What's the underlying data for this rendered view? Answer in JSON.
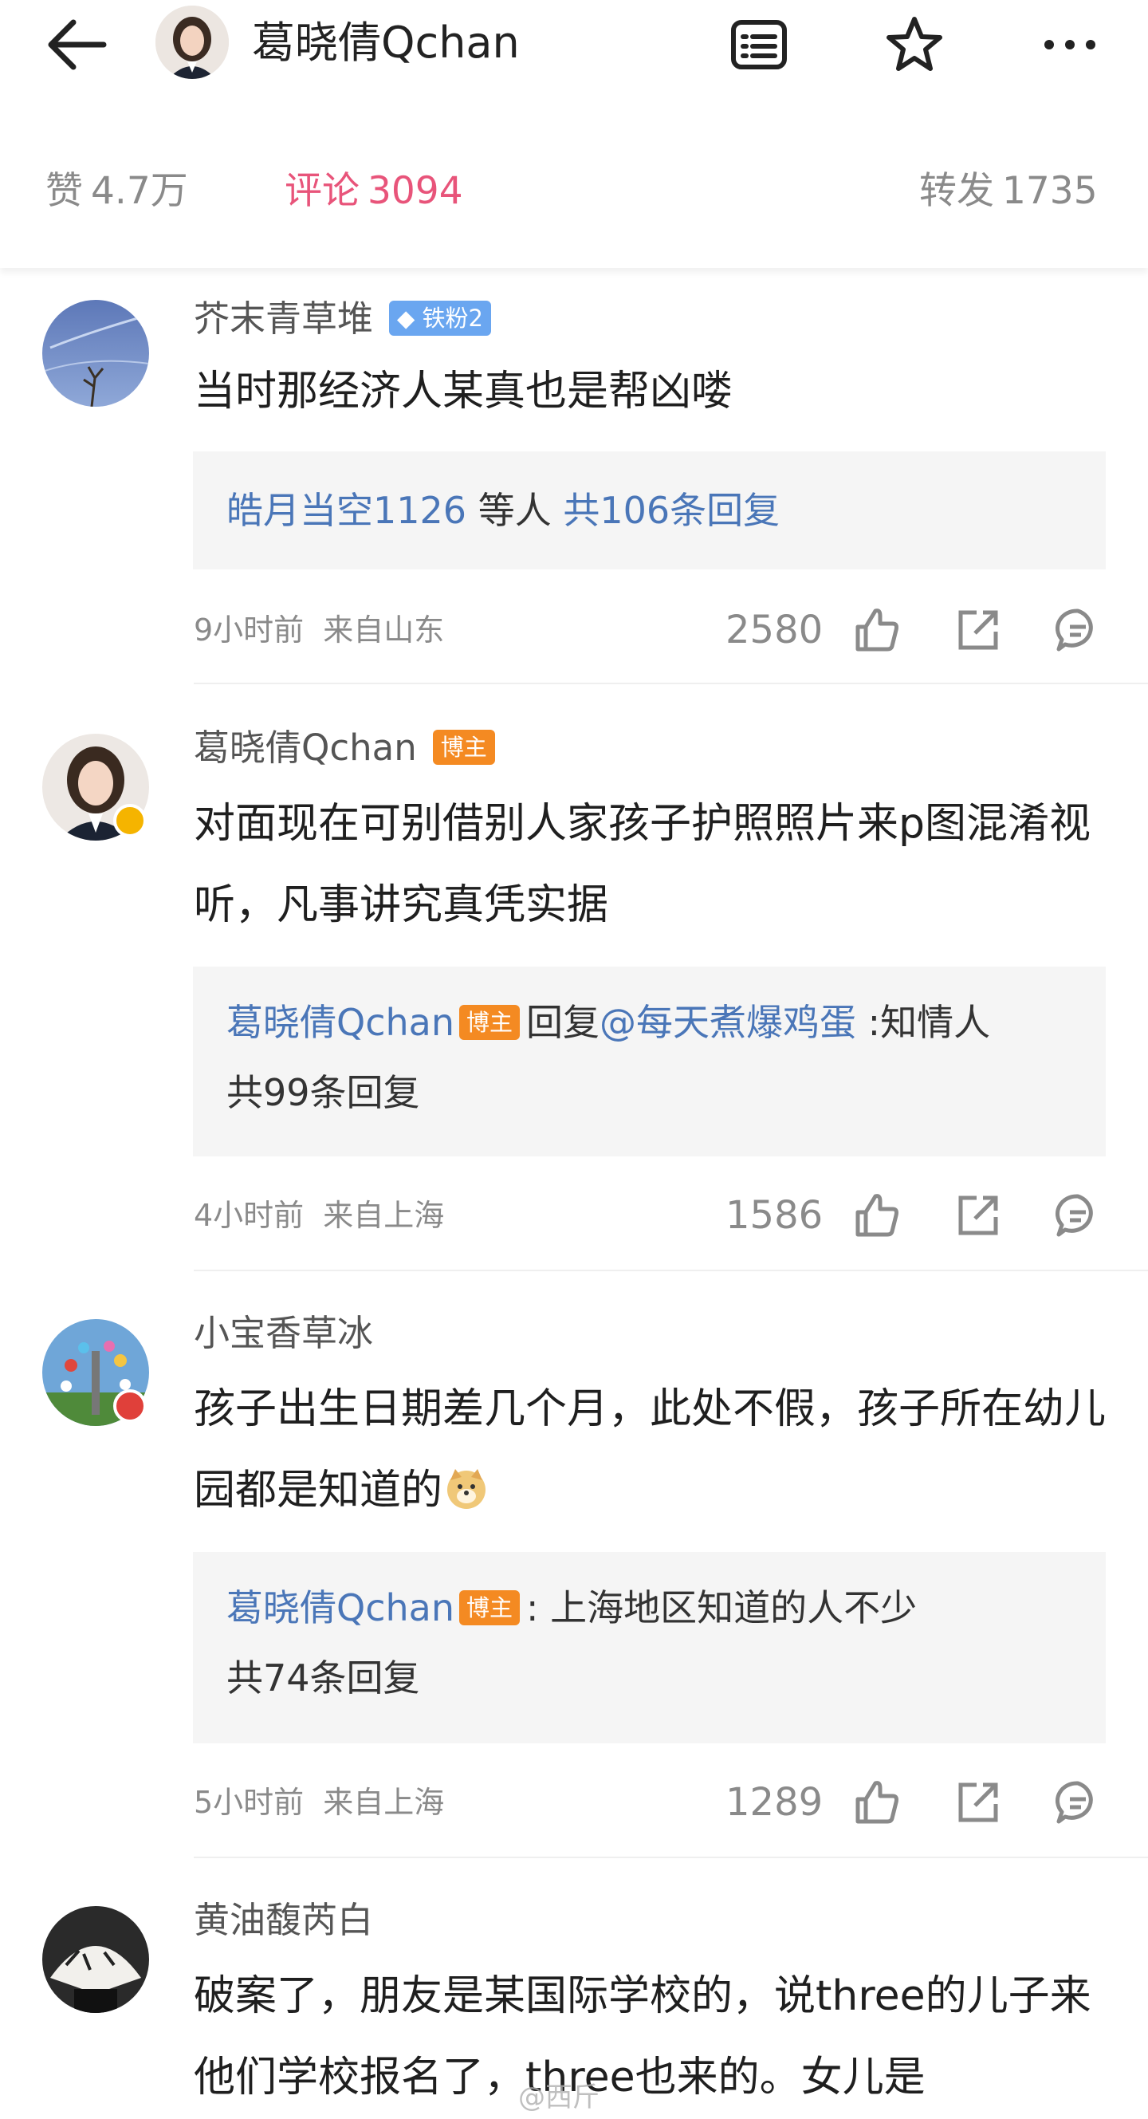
{
  "header": {
    "title": "葛晓倩Qchan"
  },
  "stats": {
    "likes_label": "赞",
    "likes_value": "4.7万",
    "comments_label": "评论",
    "comments_value": "3094",
    "reposts_label": "转发",
    "reposts_value": "1735"
  },
  "comments": [
    {
      "user": "芥末青草堆",
      "tag": "铁粉2",
      "text": "当时那经济人某真也是帮凶喽",
      "reply_user": "皓月当空1126",
      "reply_mid": "等人",
      "reply_count": "共106条回复",
      "time": "9小时前",
      "location": "来自山东",
      "likes": "2580"
    },
    {
      "user": "葛晓倩Qchan",
      "tag": "博主",
      "text": "对面现在可别借别人家孩子护照照片来p图混淆视听，凡事讲究真凭实据",
      "reply_user": "葛晓倩Qchan",
      "reply_tag": "博主",
      "reply_action": "回复",
      "reply_target": "@每天煮爆鸡蛋",
      "reply_text": ":知情人",
      "reply_count": "共99条回复",
      "time": "4小时前",
      "location": "来自上海",
      "likes": "1586"
    },
    {
      "user": "小宝香草冰",
      "text": "孩子出生日期差几个月，此处不假，孩子所在幼儿园都是知道的",
      "reply_user": "葛晓倩Qchan",
      "reply_tag": "博主",
      "reply_text": ": 上海地区知道的人不少",
      "reply_count": "共74条回复",
      "time": "5小时前",
      "location": "来自上海",
      "likes": "1289"
    },
    {
      "user": "黄油馥芮白",
      "text": "破案了，朋友是某国际学校的，说three的儿子来他们学校报名了，three也来的。女儿是"
    }
  ],
  "watermark": "@西斤",
  "icons": [
    "back-arrow-icon",
    "list-icon",
    "star-icon",
    "more-icon",
    "thumbs-up-icon",
    "share-icon",
    "comment-icon",
    "verified-icon"
  ],
  "colors": {
    "accent": "#e8547a",
    "link": "#4a76b8",
    "host_tag": "#f48a22",
    "fan_tag": "#6aa6f0"
  }
}
